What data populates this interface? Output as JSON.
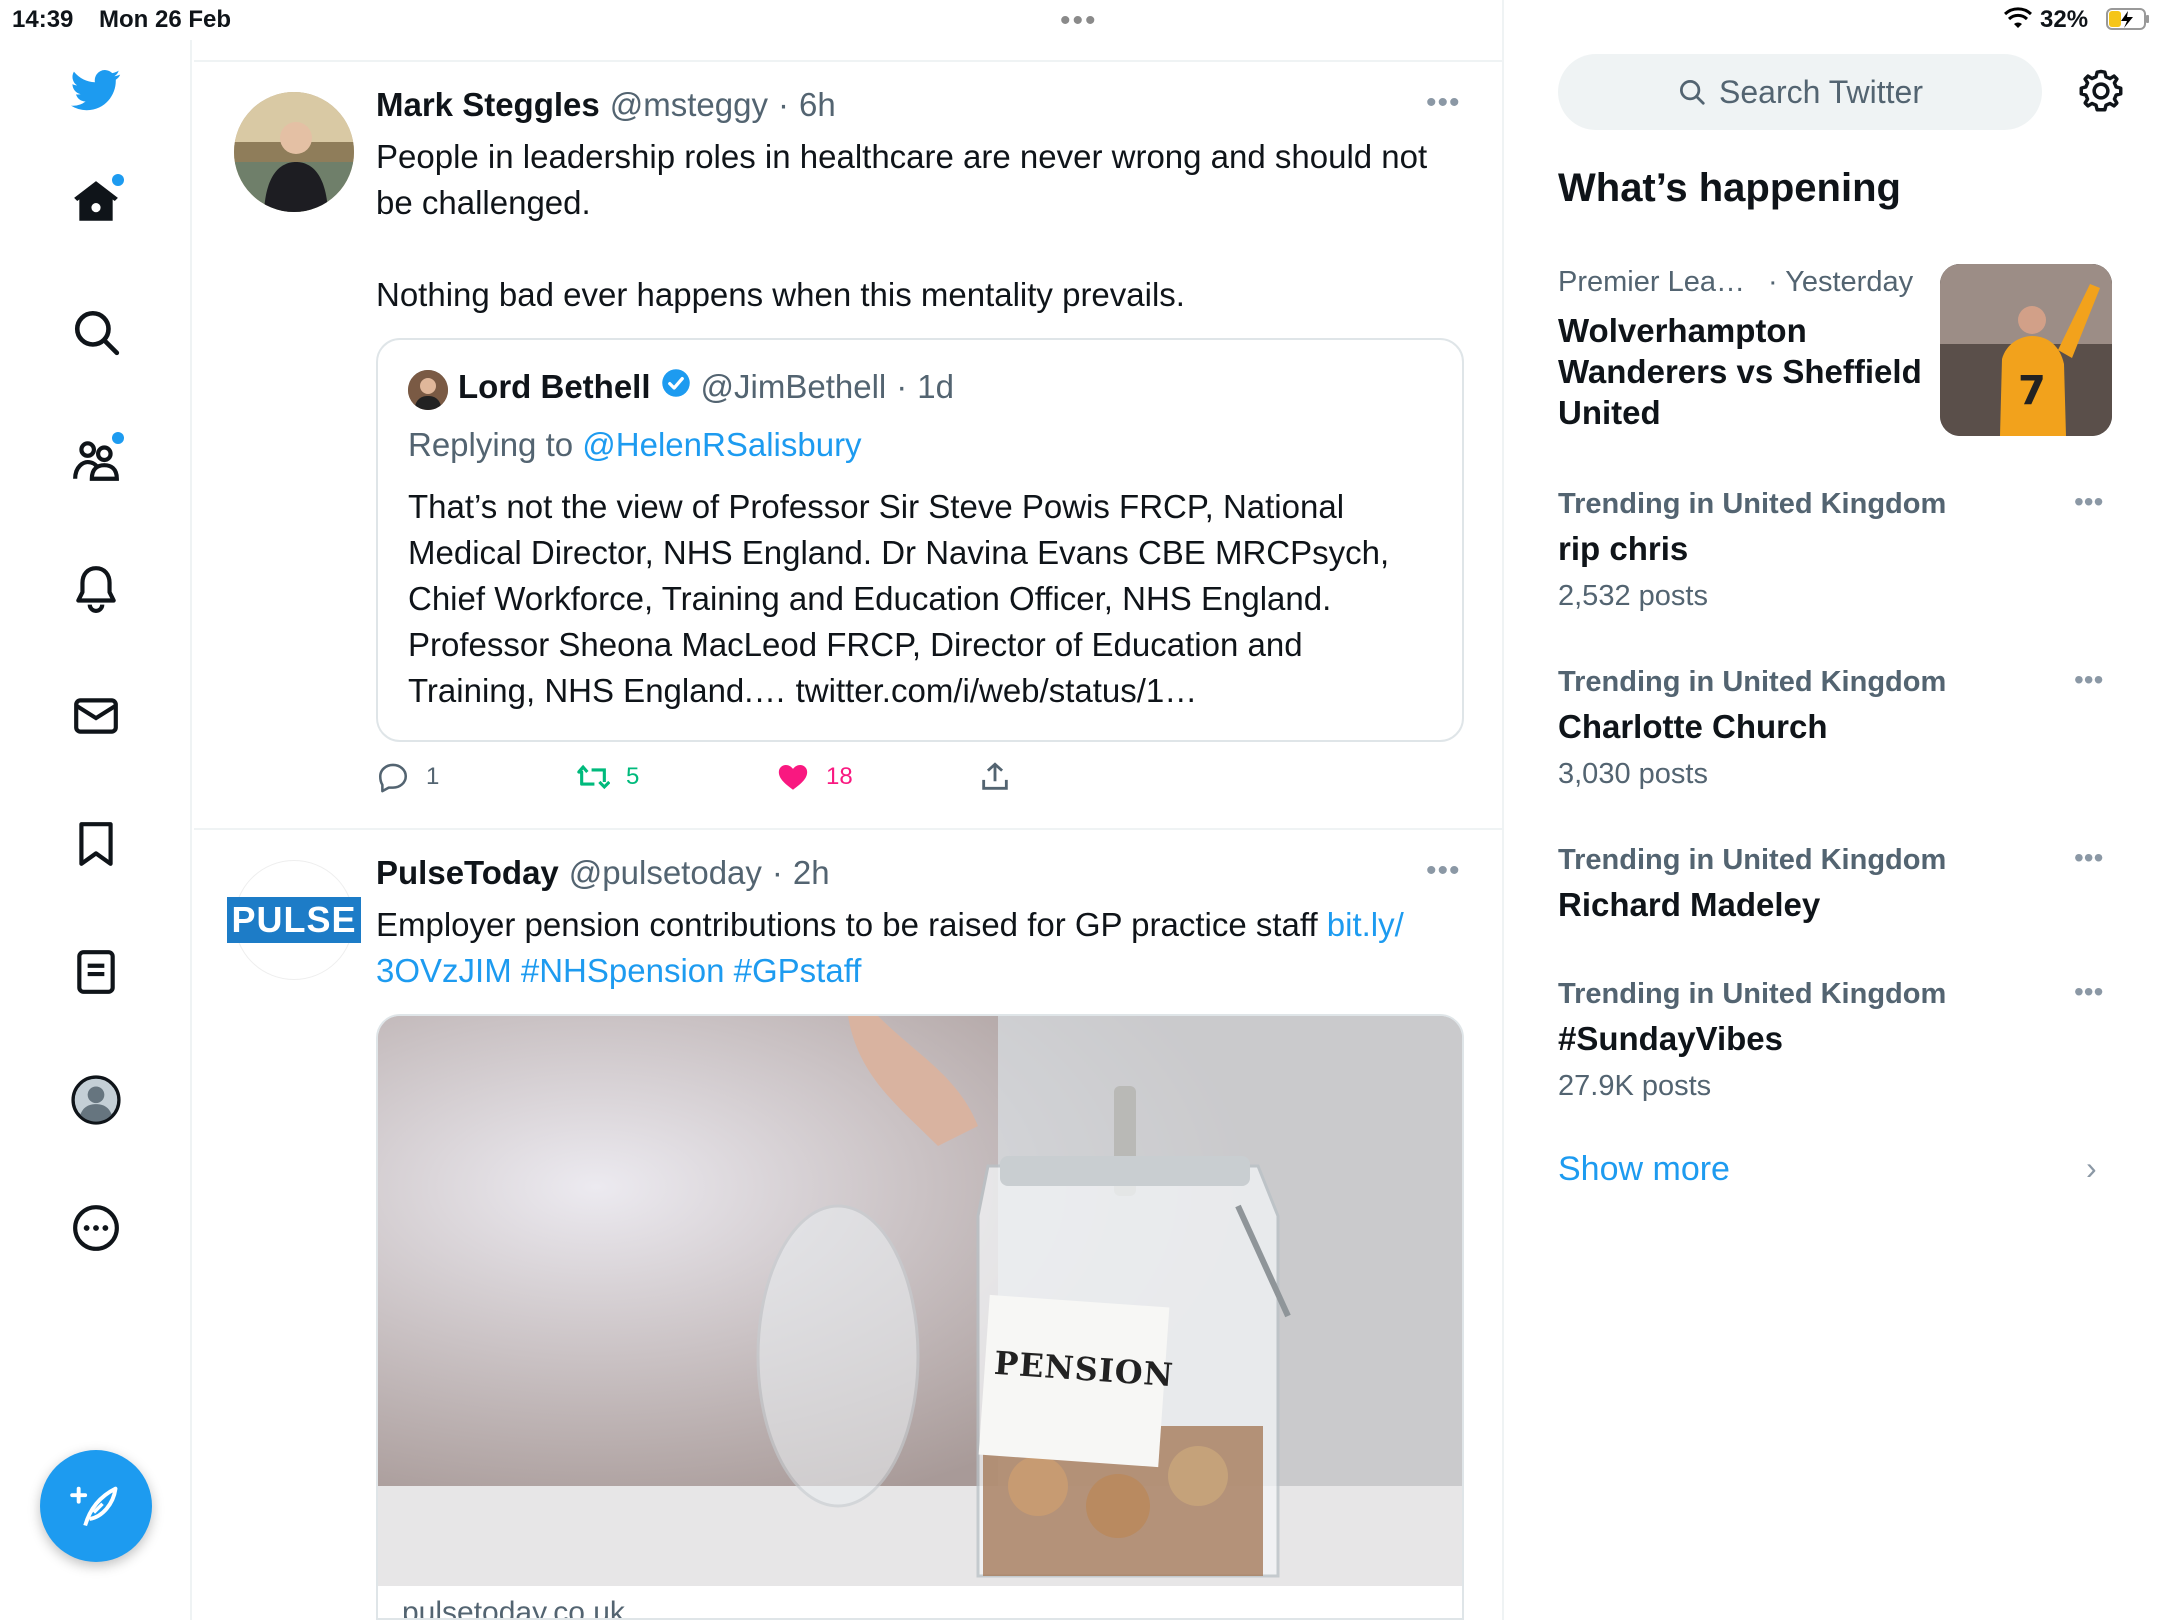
{
  "status_bar": {
    "time": "14:39",
    "date": "Mon 26 Feb",
    "battery": "32%"
  },
  "nav": {
    "items": [
      "twitter-logo",
      "home",
      "explore",
      "communities",
      "notifications",
      "messages",
      "bookmarks",
      "lists",
      "profile",
      "more"
    ],
    "accent": "#1d9bf0"
  },
  "tweets": [
    {
      "name": "Mark Steggles",
      "handle": "@msteggy",
      "sep": "·",
      "time": "6h",
      "text_1": "People in leadership roles in healthcare are never wrong and should not be challenged.",
      "text_2": "Nothing bad ever happens when this mentality prevails.",
      "quote": {
        "name": "Lord Bethell",
        "handle": "@JimBethell",
        "sep": "·",
        "time": "1d",
        "replying_prefix": "Replying to",
        "replying_to": "@HelenRSalisbury",
        "text": "That’s not the view of Professor Sir Steve Powis FRCP, National Medical Director, NHS England. Dr Navina Evans CBE MRCPsych, Chief Workforce, Training and Education Officer, NHS England. Professor Sheona MacLeod FRCP, Director of Education and Training, NHS England.… twitter.com/i/web/status/1…"
      },
      "actions": {
        "replies": "1",
        "retweets": "5",
        "likes": "18"
      }
    },
    {
      "name": "PulseToday",
      "handle": "@pulsetoday",
      "sep": "·",
      "time": "2h",
      "avatar_text": "PULSE",
      "text_plain": "Employer pension contributions to be raised for GP practice staff ",
      "link_1": "bit.ly/",
      "link_2": "3OVzJIM #NHSpension #GPstaff",
      "media_label": "PENSION",
      "card_domain": "pulsetoday.co.uk"
    }
  ],
  "sidebar": {
    "search_placeholder": "Search Twitter",
    "section_title": "What’s happening",
    "trends": [
      {
        "meta": "Premier Lea…",
        "meta2": "· Yesterday",
        "name": "Wolverhampton Wanderers vs Sheffield United",
        "count": ""
      },
      {
        "meta": "Trending in United Kingdom",
        "name": "rip chris",
        "count": "2,532 posts"
      },
      {
        "meta": "Trending in United Kingdom",
        "name": "Charlotte Church",
        "count": "3,030 posts"
      },
      {
        "meta": "Trending in United Kingdom",
        "name": "Richard Madeley",
        "count": ""
      },
      {
        "meta": "Trending in United Kingdom",
        "name": "#SundayVibes",
        "count": "27.9K posts"
      }
    ],
    "show_more": "Show more"
  }
}
